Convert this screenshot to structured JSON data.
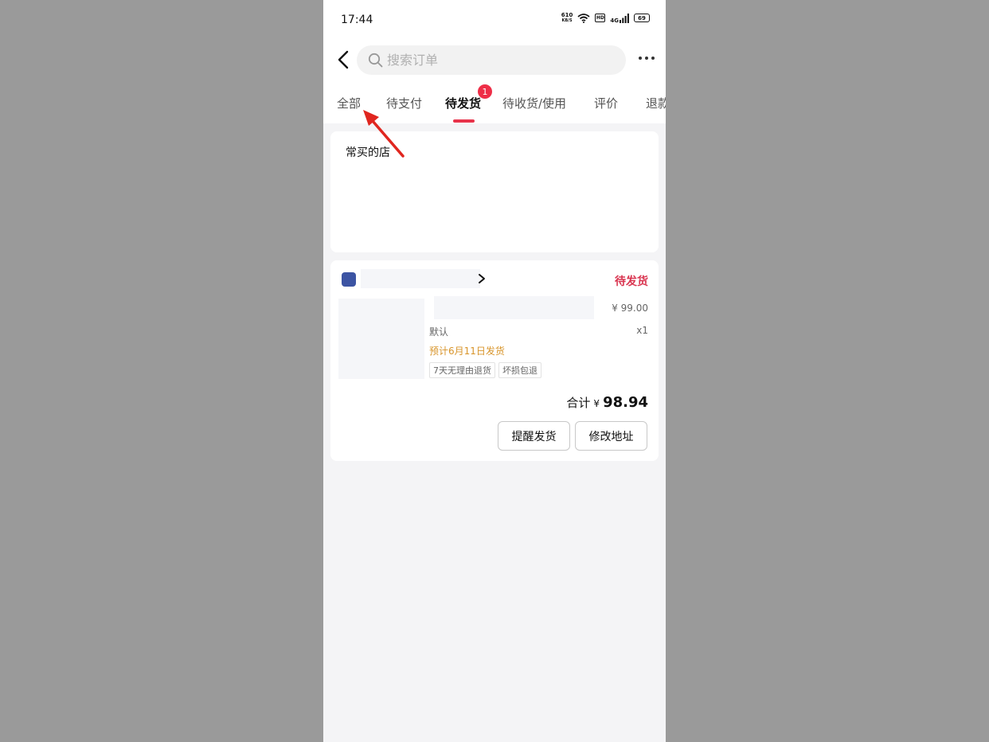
{
  "status_bar": {
    "time": "17:44",
    "net_speed_value": "610",
    "net_speed_unit": "KB/S",
    "hd": "HD",
    "network": "4G",
    "battery": "69"
  },
  "header": {
    "search_placeholder": "搜索订单"
  },
  "tabs": [
    {
      "label": "全部",
      "active": false
    },
    {
      "label": "待支付",
      "active": false
    },
    {
      "label": "待发货",
      "active": true,
      "badge": "1"
    },
    {
      "label": "待收货/使用",
      "active": false
    },
    {
      "label": "评价",
      "active": false
    },
    {
      "label": "退款",
      "active": false
    }
  ],
  "favorites": {
    "title": "常买的店"
  },
  "order": {
    "status": "待发货",
    "price": "¥ 99.00",
    "sku": "默认",
    "quantity": "x1",
    "ship_date": "预计6月11日发货",
    "tags": [
      "7天无理由退货",
      "坏损包退"
    ],
    "total_label": "合计",
    "total_currency": "¥",
    "total_amount": "98.94",
    "buttons": {
      "remind": "提醒发货",
      "address": "修改地址"
    }
  },
  "colors": {
    "accent": "#e8334a",
    "ship_date": "#d8952b",
    "shop_logo": "#3c54a3",
    "annotation_arrow": "#e0261f"
  }
}
